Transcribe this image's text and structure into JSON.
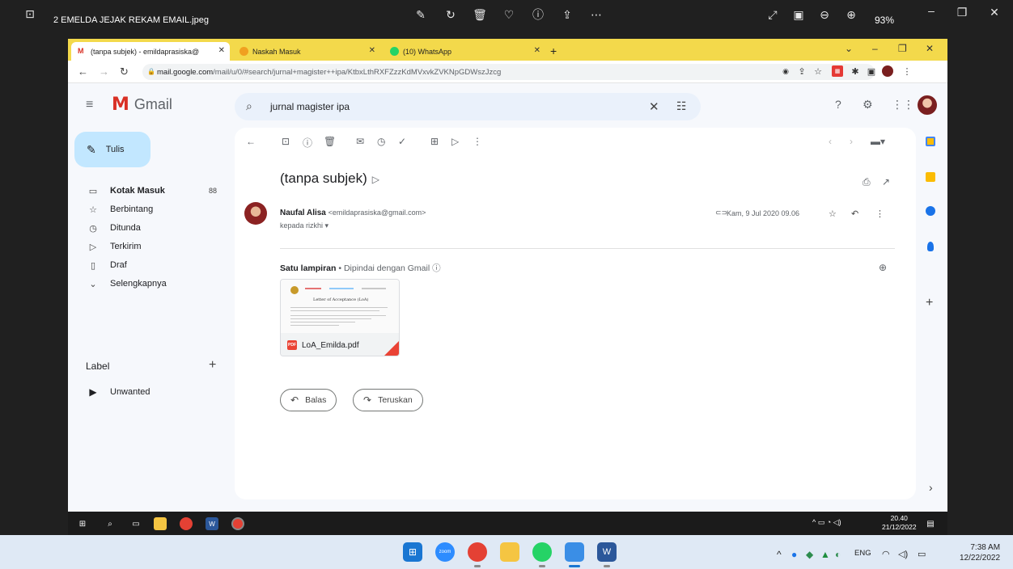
{
  "viewer": {
    "title": "2 EMELDA JEJAK REKAM EMAIL.jpeg",
    "zoom": "93%"
  },
  "browser": {
    "tabs": [
      {
        "label": "(tanpa subjek) - emildaprasiska@",
        "favicon": "gmail-icon"
      },
      {
        "label": "Naskah Masuk",
        "favicon": "journal-icon"
      },
      {
        "label": "(10) WhatsApp",
        "favicon": "whatsapp-icon"
      }
    ],
    "url_host": "mail.google.com",
    "url_path": "/mail/u/0/#search/jurnal+magister++ipa/KtbxLthRXFZzzKdMVxvkZVKNpGDWszJzcg"
  },
  "gmail": {
    "logo_text": "Gmail",
    "search_value": "jurnal magister ipa",
    "compose_label": "Tulis",
    "nav": [
      {
        "label": "Kotak Masuk",
        "count": "88",
        "icon": "inbox-icon",
        "glyph": "▭"
      },
      {
        "label": "Berbintang",
        "count": "",
        "icon": "star-icon",
        "glyph": "☆"
      },
      {
        "label": "Ditunda",
        "count": "",
        "icon": "clock-icon",
        "glyph": "◷"
      },
      {
        "label": "Terkirim",
        "count": "",
        "icon": "send-icon",
        "glyph": "▷"
      },
      {
        "label": "Draf",
        "count": "",
        "icon": "draft-icon",
        "glyph": "▯"
      },
      {
        "label": "Selengkapnya",
        "count": "",
        "icon": "chevron-down-icon",
        "glyph": "⌄"
      }
    ],
    "label_heading": "Label",
    "labels": [
      {
        "label": "Unwanted"
      }
    ],
    "email": {
      "subject": "(tanpa subjek)",
      "sender_name": "Naufal Alisa",
      "sender_email": "<emildaprasiska@gmail.com>",
      "recipient": "kepada rizkhi",
      "date": "Kam, 9 Jul 2020 09.06",
      "attach_count": "Satu lampiran",
      "scan_note": "Dipindai dengan Gmail",
      "attachment_name": "LoA_Emilda.pdf",
      "attachment_doc_title": "Letter of Acceptance (LoA)",
      "reply_label": "Balas",
      "forward_label": "Teruskan"
    }
  },
  "inner_taskbar": {
    "time": "20.40",
    "date": "21/12/2022"
  },
  "taskbar": {
    "lang": "ENG",
    "time": "7:38 AM",
    "date": "12/22/2022",
    "zoom_app_label": "zoom"
  },
  "colors": {
    "tab_strip": "#f3d94b",
    "gmail_bg": "#f6f8fc",
    "compose_bg": "#c2e7ff",
    "search_bg": "#eaf1fb",
    "gmail_red": "#d93025"
  }
}
